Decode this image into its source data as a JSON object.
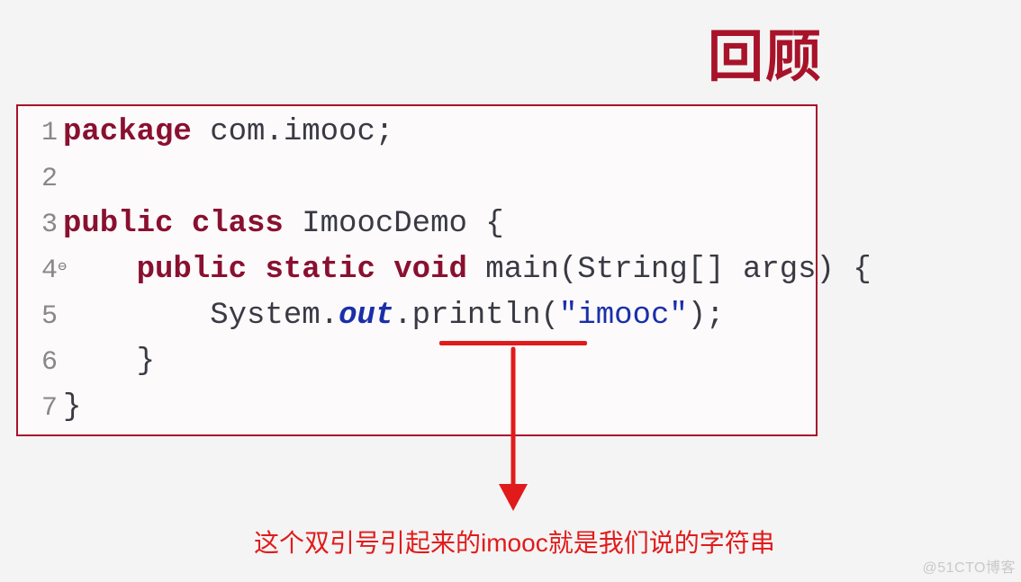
{
  "title": "回顾",
  "code": {
    "lines": [
      {
        "n": "1",
        "marker": "",
        "segments": [
          {
            "cls": "kw",
            "t": "package"
          },
          {
            "cls": "ident",
            "t": " com.imooc;"
          }
        ]
      },
      {
        "n": "2",
        "marker": "",
        "segments": []
      },
      {
        "n": "3",
        "marker": "",
        "segments": [
          {
            "cls": "kw",
            "t": "public class"
          },
          {
            "cls": "ident",
            "t": " ImoocDemo {"
          }
        ]
      },
      {
        "n": "4",
        "marker": "⊖",
        "segments": [
          {
            "cls": "ident",
            "t": "    "
          },
          {
            "cls": "kw",
            "t": "public static void"
          },
          {
            "cls": "ident",
            "t": " main(String[] args) {"
          }
        ]
      },
      {
        "n": "5",
        "marker": "",
        "segments": [
          {
            "cls": "ident",
            "t": "        System."
          },
          {
            "cls": "out",
            "t": "out"
          },
          {
            "cls": "ident",
            "t": ".println("
          },
          {
            "cls": "str",
            "t": "\"imooc\""
          },
          {
            "cls": "ident",
            "t": ");"
          }
        ]
      },
      {
        "n": "6",
        "marker": "",
        "segments": [
          {
            "cls": "ident",
            "t": "    }"
          }
        ]
      },
      {
        "n": "7",
        "marker": "",
        "segments": [
          {
            "cls": "ident",
            "t": "}"
          }
        ]
      }
    ]
  },
  "caption": "这个双引号引起来的imooc就是我们说的字符串",
  "watermark": "@51CTO博客"
}
